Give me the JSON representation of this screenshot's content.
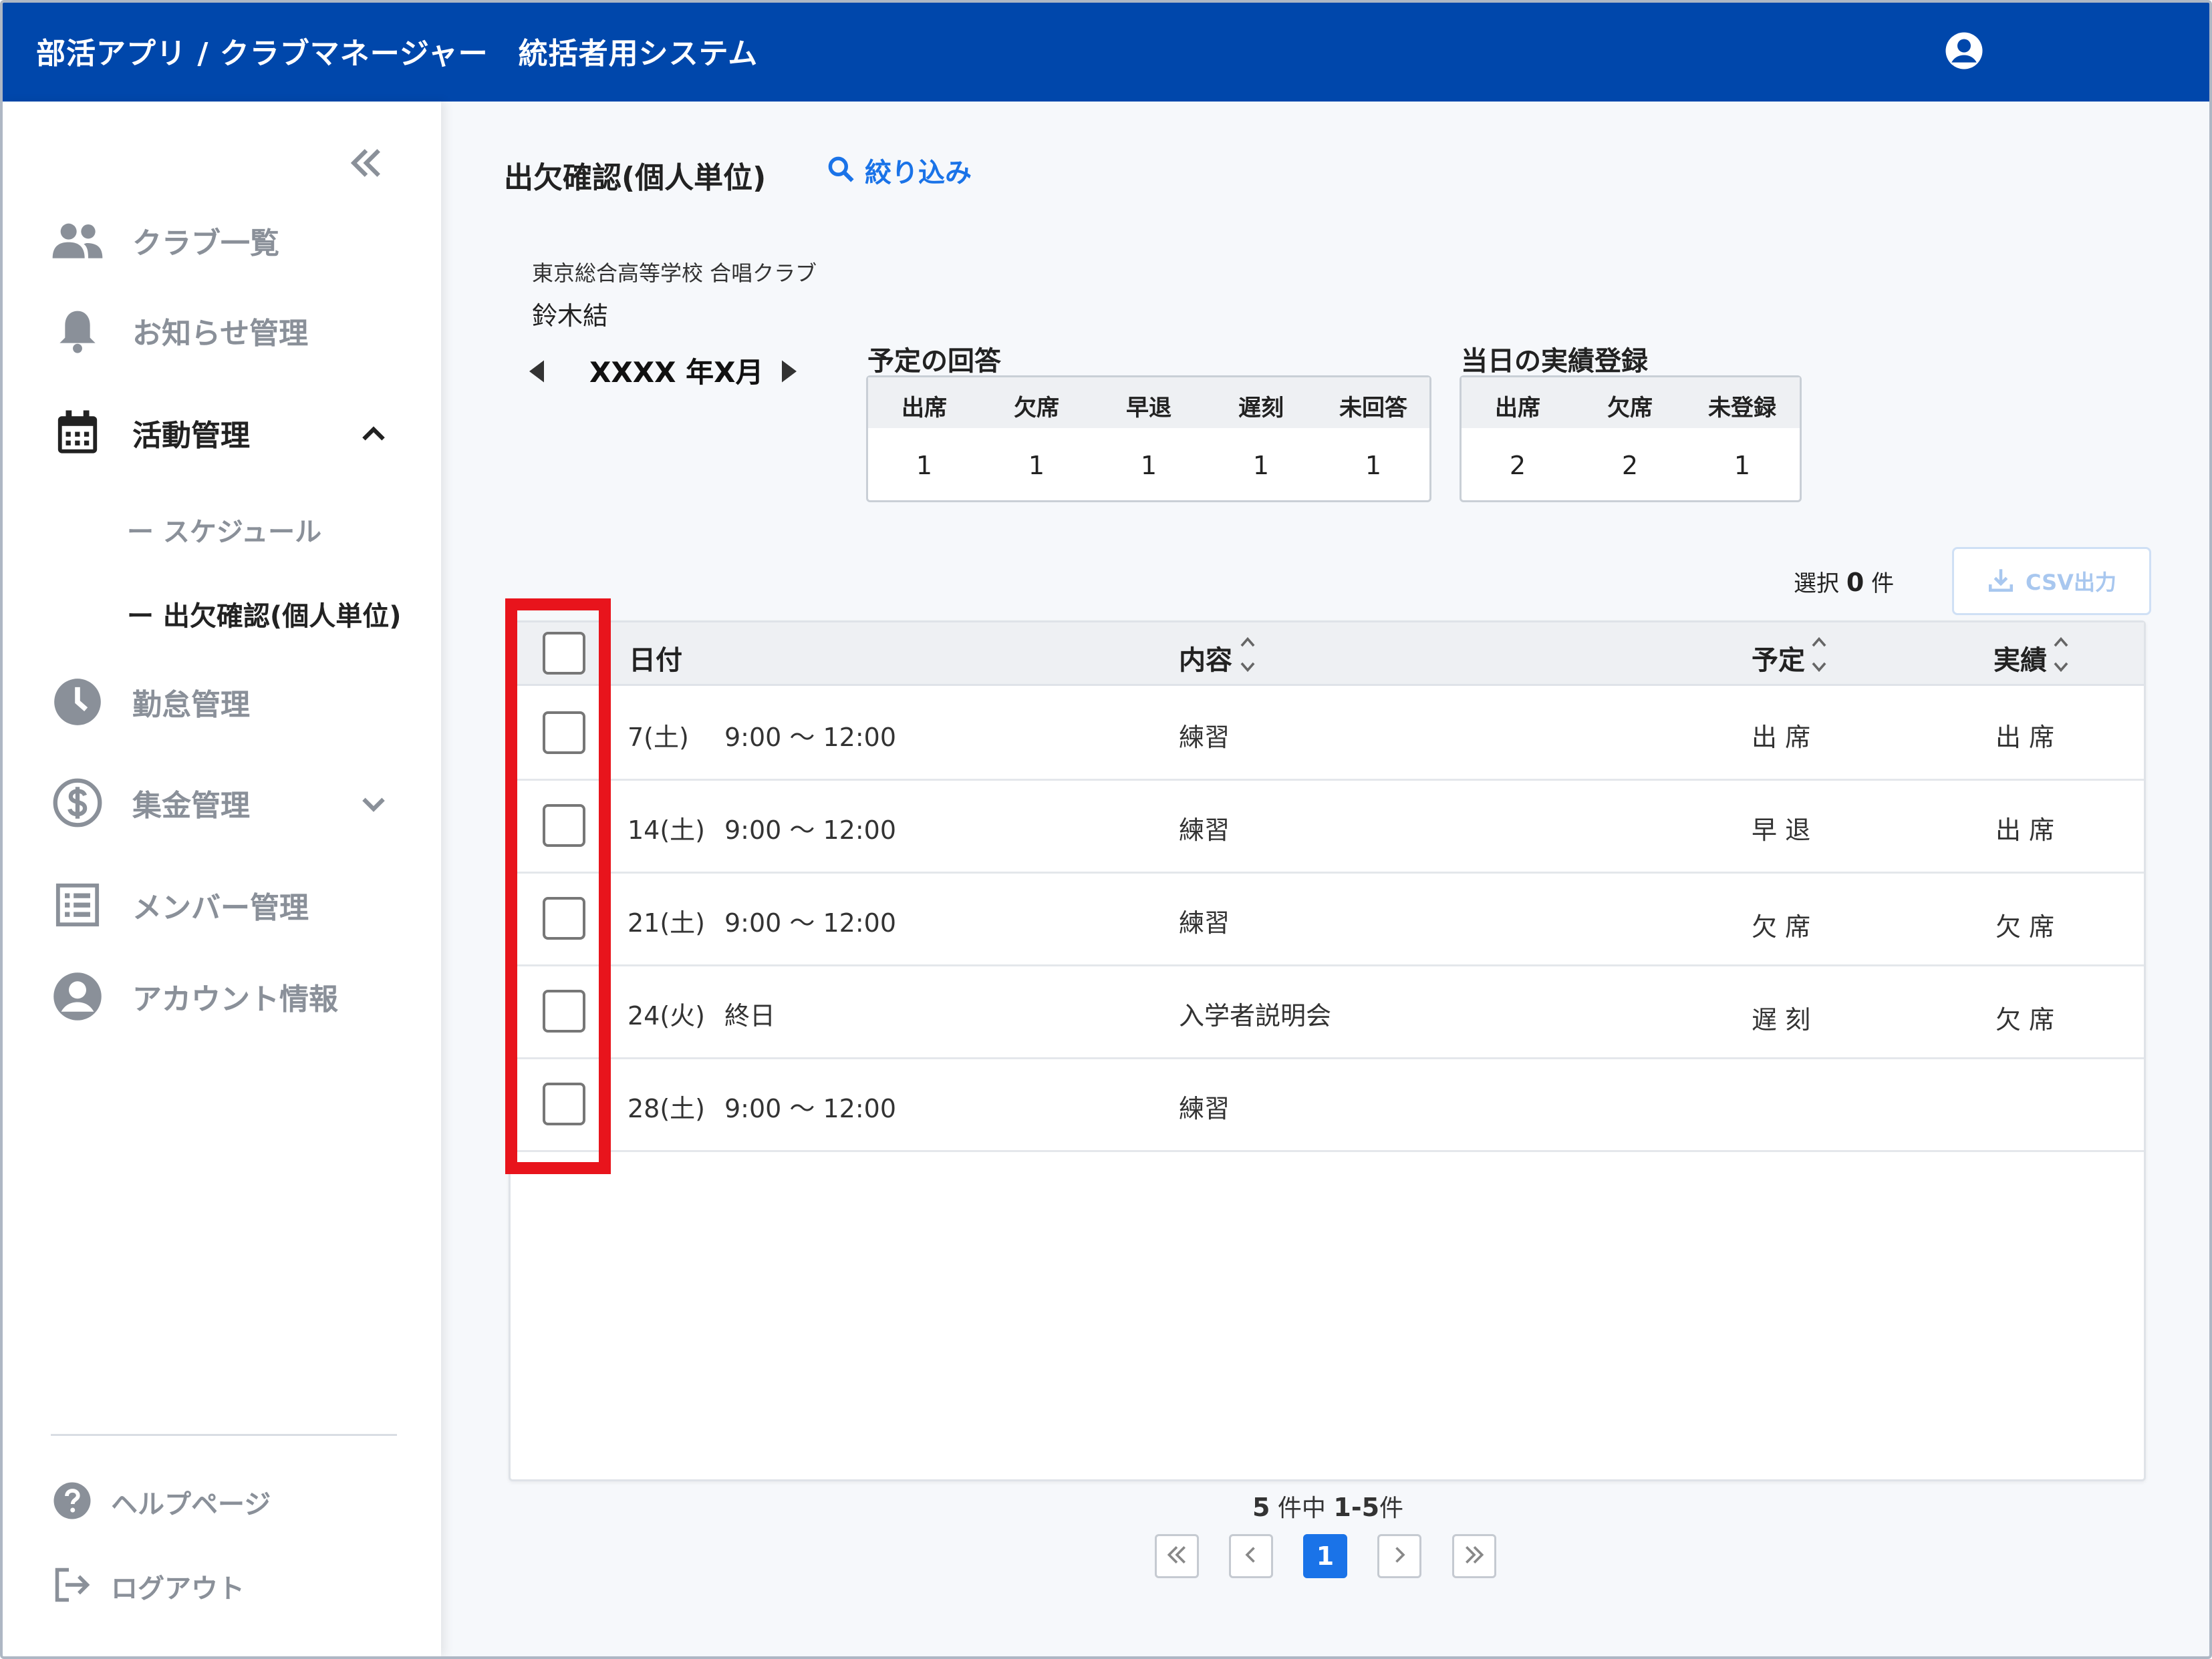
{
  "header": {
    "title": "部活アプリ / クラブマネージャー　統括者用システム",
    "user_icon": "account-circle-icon"
  },
  "sidebar": {
    "collapse_icon": "double-chevron-left-icon",
    "items": [
      {
        "label": "クラブ一覧",
        "icon": "people-icon"
      },
      {
        "label": "お知らせ管理",
        "icon": "bell-icon"
      },
      {
        "label": "活動管理",
        "icon": "calendar-icon",
        "expanded": true
      },
      {
        "label": "勤怠管理",
        "icon": "clock-icon"
      },
      {
        "label": "集金管理",
        "icon": "dollar-circle-icon"
      },
      {
        "label": "メンバー管理",
        "icon": "list-icon"
      },
      {
        "label": "アカウント情報",
        "icon": "account-circle-icon"
      }
    ],
    "sub_items": [
      {
        "label": "ー スケジュール"
      },
      {
        "label": "ー 出欠確認(個人単位)",
        "active": true
      }
    ],
    "footer": [
      {
        "label": "ヘルプページ",
        "icon": "help-icon"
      },
      {
        "label": "ログアウト",
        "icon": "logout-icon"
      }
    ]
  },
  "main": {
    "title": "出欠確認(個人単位)",
    "filter_label": "絞り込み",
    "school": "東京総合高等学校 合唱クラブ",
    "member": "鈴木結",
    "month": "XXXX 年X月",
    "plan_summary": {
      "title": "予定の回答",
      "headers": [
        "出席",
        "欠席",
        "早退",
        "遅刻",
        "未回答"
      ],
      "values": [
        "1",
        "1",
        "1",
        "1",
        "1"
      ]
    },
    "actual_summary": {
      "title": "当日の実績登録",
      "headers": [
        "出席",
        "欠席",
        "未登録"
      ],
      "values": [
        "2",
        "2",
        "1"
      ]
    },
    "selection": {
      "prefix": "選択",
      "count": "0",
      "suffix": "件"
    },
    "csv_label": "CSV出力",
    "table": {
      "headers": {
        "date": "日付",
        "content": "内容",
        "plan": "予定",
        "actual": "実績"
      },
      "rows": [
        {
          "date": "7(土)",
          "time": "9:00 〜 12:00",
          "content": "練習",
          "plan": "出 席",
          "actual": "出 席"
        },
        {
          "date": "14(土)",
          "time": "9:00 〜 12:00",
          "content": "練習",
          "plan": "早 退",
          "actual": "出 席"
        },
        {
          "date": "21(土)",
          "time": "9:00 〜 12:00",
          "content": "練習",
          "plan": "欠 席",
          "actual": "欠 席"
        },
        {
          "date": "24(火)",
          "time": "終日",
          "content": "入学者説明会",
          "plan": "遅 刻",
          "actual": "欠 席"
        },
        {
          "date": "28(土)",
          "time": "9:00 〜 12:00",
          "content": "練習",
          "plan": "",
          "actual": ""
        }
      ]
    },
    "pagination": {
      "total": "5",
      "total_suffix": "件中",
      "range": "1-5",
      "range_suffix": "件",
      "current_page": "1"
    }
  },
  "colors": {
    "header_bg": "#0047ab",
    "accent": "#1a73e8",
    "highlight": "#e8141c"
  }
}
